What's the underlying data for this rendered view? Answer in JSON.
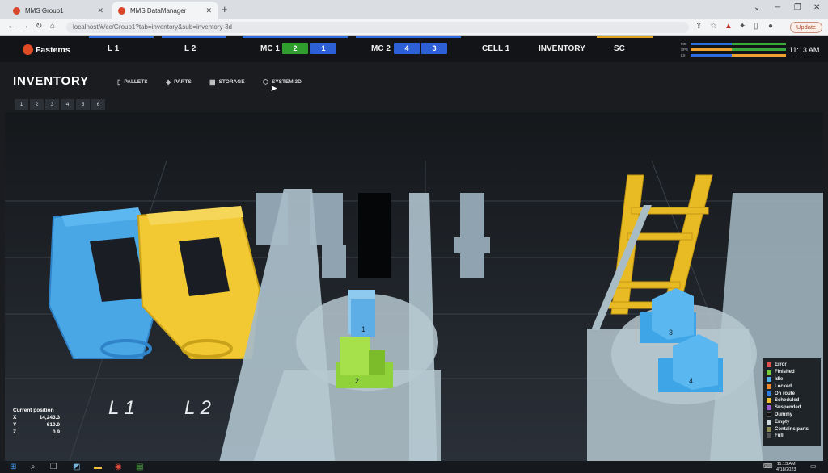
{
  "browser": {
    "tabs": [
      {
        "label": "MMS Group1",
        "active": false
      },
      {
        "label": "MMS DataManager",
        "active": true
      }
    ],
    "url": "localhost/#/cc/Group1?tab=inventory&sub=inventory-3d",
    "update_label": "Update"
  },
  "header": {
    "logo": "Fastems",
    "nav": [
      "L 1",
      "L 2",
      "MC 1",
      "MC 2",
      "CELL 1",
      "INVENTORY",
      "SC"
    ],
    "mc1_badges": [
      "2",
      "1"
    ],
    "mc2_badges": [
      "4",
      "3"
    ],
    "status_rows": [
      {
        "label": "MC",
        "colors": [
          "#2d6de0",
          "#3aa83a"
        ]
      },
      {
        "label": "SPS",
        "colors": [
          "#f0a030",
          "#3aa83a"
        ]
      },
      {
        "label": "LS",
        "colors": [
          "#2d6de0",
          "#f0a030"
        ]
      }
    ],
    "clock": "11:13 AM"
  },
  "page": {
    "title": "INVENTORY",
    "subnav": [
      {
        "label": "PALLETS",
        "icon": "pallet-icon"
      },
      {
        "label": "PARTS",
        "icon": "parts-icon"
      },
      {
        "label": "STORAGE",
        "icon": "grid-icon"
      },
      {
        "label": "SYSTEM 3D",
        "icon": "cube-icon"
      }
    ],
    "page_buttons": [
      "1",
      "2",
      "3",
      "4",
      "5",
      "6"
    ]
  },
  "scene": {
    "station_labels": [
      "L 1",
      "L 2"
    ],
    "pallet_numbers": [
      "1",
      "2",
      "3",
      "4"
    ]
  },
  "position": {
    "title": "Current position",
    "x_label": "X",
    "x_value": "14,243.3",
    "y_label": "Y",
    "y_value": "610.0",
    "z_label": "Z",
    "z_value": "0.9"
  },
  "legend": [
    {
      "label": "Error",
      "color": "#e05050"
    },
    {
      "label": "Finished",
      "color": "#7acc3c"
    },
    {
      "label": "Idle",
      "color": "#4fb0e8"
    },
    {
      "label": "Locked",
      "color": "#f08a2a"
    },
    {
      "label": "On route",
      "color": "#2d7de0"
    },
    {
      "label": "Scheduled",
      "color": "#f0c030"
    },
    {
      "label": "Suspended",
      "color": "#9a5fd0"
    },
    {
      "label": "Dummy",
      "color": "#111111"
    },
    {
      "label": "Empty",
      "color": "#cfd8dc"
    },
    {
      "label": "Contains parts",
      "color": "#8a8a5a"
    },
    {
      "label": "Full",
      "color": "#555555"
    }
  ],
  "taskbar": {
    "time": "11:13 AM",
    "date": "4/18/2023"
  }
}
